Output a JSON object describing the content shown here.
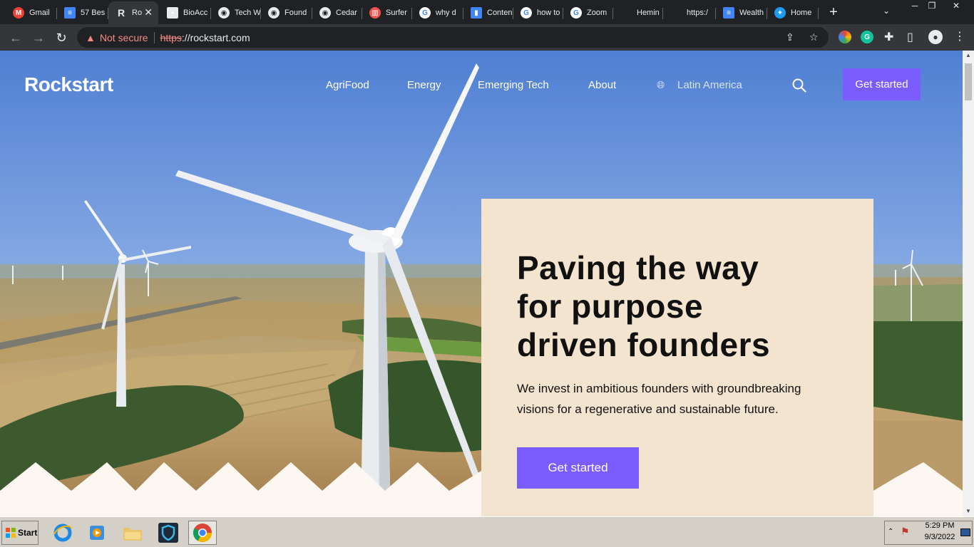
{
  "browser": {
    "tabs": [
      {
        "label": "Gmail",
        "icon": "gmail-icon",
        "color": "#ea4335",
        "glyph": "M"
      },
      {
        "label": "57 Bes",
        "icon": "docs-icon",
        "color": "#4285f4",
        "glyph": "≡"
      },
      {
        "label": "Ro",
        "icon": "rockstart-icon",
        "color": "#35363a",
        "glyph": "R",
        "active": true
      },
      {
        "label": "BioAcc",
        "icon": "page-icon",
        "color": "#e8eaed",
        "glyph": "▪"
      },
      {
        "label": "Tech W",
        "icon": "globe-icon",
        "color": "#e8eaed",
        "glyph": "◉"
      },
      {
        "label": "Found",
        "icon": "globe-icon",
        "color": "#e8eaed",
        "glyph": "◉"
      },
      {
        "label": "Cedar",
        "icon": "globe-icon",
        "color": "#e8eaed",
        "glyph": "◉"
      },
      {
        "label": "Surfer",
        "icon": "surfer-icon",
        "color": "#ef5350",
        "glyph": "▥"
      },
      {
        "label": "why d",
        "icon": "google-icon",
        "color": "#ffffff",
        "glyph": "G"
      },
      {
        "label": "Conten",
        "icon": "file-icon",
        "color": "#4285f4",
        "glyph": "▮"
      },
      {
        "label": "how to",
        "icon": "google-icon",
        "color": "#ffffff",
        "glyph": "G"
      },
      {
        "label": "Zoom",
        "icon": "google-icon",
        "color": "#ffffff",
        "glyph": "G"
      },
      {
        "label": "Hemin",
        "icon": "hemingway-icon",
        "color": "#202124",
        "glyph": ""
      },
      {
        "label": "https:/",
        "icon": "blank-icon",
        "color": "#202124",
        "glyph": ""
      },
      {
        "label": "Wealth",
        "icon": "docs-icon",
        "color": "#4285f4",
        "glyph": "≡"
      },
      {
        "label": "Home",
        "icon": "twitter-icon",
        "color": "#1d9bf0",
        "glyph": "✦"
      }
    ],
    "new_tab": "+",
    "tab_search": "⌄",
    "window_controls": {
      "minimize": "─",
      "restore": "❐",
      "close": "✕"
    },
    "nav": {
      "back": "←",
      "forward": "→",
      "reload": "↻"
    },
    "security_label": "Not secure",
    "url_scheme": "https",
    "url_rest": "://rockstart.com",
    "omnibox_icons": {
      "share": "⇪",
      "bookmark": "☆"
    },
    "extensions": [
      {
        "name": "chromium-ext-icon",
        "color": "#e8eaed",
        "glyph": ""
      },
      {
        "name": "grammarly-icon",
        "color": "#15c39a",
        "glyph": "G"
      }
    ],
    "toolbar_icons": {
      "extensions": "✚",
      "sidepanel": "▯",
      "profile": "●",
      "menu": "⋮"
    }
  },
  "site": {
    "logo": "Rockstart",
    "nav": [
      "AgriFood",
      "Energy",
      "Emerging Tech",
      "About"
    ],
    "region": "Latin America",
    "cta_top": "Get started",
    "headline_lines": [
      "Paving the way",
      "for purpose",
      "driven founders"
    ],
    "subtext": "We invest in ambitious founders with groundbreaking visions for a regenerative and sustainable future.",
    "cta_hero": "Get started",
    "colors": {
      "accent": "#7b5cff",
      "card": "#f3e4cf",
      "sky": "#5b86d4"
    }
  },
  "taskbar": {
    "start": "Start",
    "apps": [
      "ie-icon",
      "media-player-icon",
      "folder-icon",
      "shield-app-icon",
      "chrome-icon"
    ],
    "clock_time": "5:29 PM",
    "clock_date": "9/3/2022"
  }
}
